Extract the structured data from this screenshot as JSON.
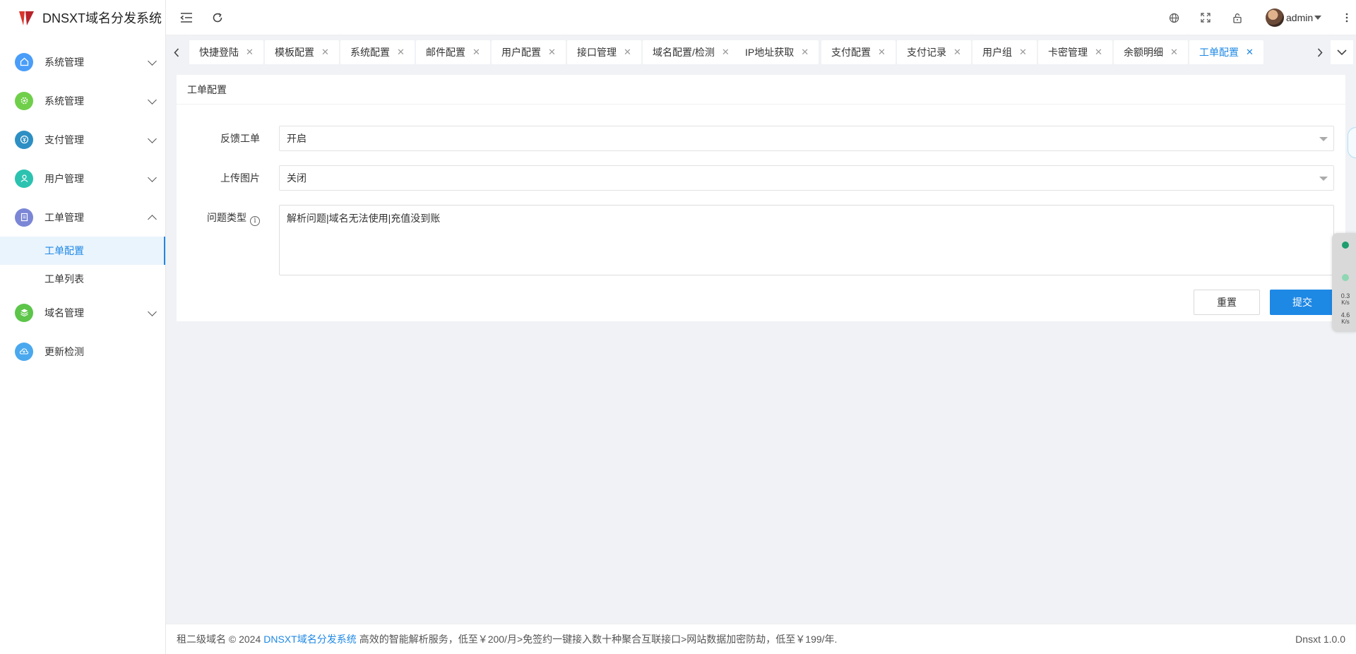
{
  "app": {
    "title": "DNSXT域名分发系统"
  },
  "sidebar": {
    "menus": [
      {
        "label": "系统管理",
        "icon": "home-icon",
        "color": "#4a9df8"
      },
      {
        "label": "系统管理",
        "icon": "gear-icon",
        "color": "#6fcf4a"
      },
      {
        "label": "支付管理",
        "icon": "payment-icon",
        "color": "#2d8fc4"
      },
      {
        "label": "用户管理",
        "icon": "user-icon",
        "color": "#2bc2b0"
      },
      {
        "label": "工单管理",
        "icon": "ticket-icon",
        "color": "#7b86d6"
      },
      {
        "label": "域名管理",
        "icon": "layers-icon",
        "color": "#5cc54a"
      },
      {
        "label": "更新检测",
        "icon": "cloud-icon",
        "color": "#4aa8ee"
      }
    ],
    "submenu": [
      "工单配置",
      "工单列表"
    ]
  },
  "header": {
    "user_name": "admin"
  },
  "tabs": [
    {
      "label": ""
    },
    {
      "label": "快捷登陆"
    },
    {
      "label": "模板配置"
    },
    {
      "label": "系统配置"
    },
    {
      "label": "邮件配置"
    },
    {
      "label": "用户配置"
    },
    {
      "label": "接口管理"
    },
    {
      "label": "域名配置/检测"
    },
    {
      "label": "IP地址获取"
    },
    {
      "label": "支付配置"
    },
    {
      "label": "支付记录"
    },
    {
      "label": "用户组"
    },
    {
      "label": "卡密管理"
    },
    {
      "label": "余额明细"
    },
    {
      "label": "工单配置"
    }
  ],
  "form": {
    "card_title": "工单配置",
    "feedback_label": "反馈工单",
    "feedback_value": "开启",
    "upload_label": "上传图片",
    "upload_value": "关闭",
    "type_label": "问题类型",
    "type_value": "解析问题|域名无法使用|充值没到账",
    "reset_label": "重置",
    "submit_label": "提交"
  },
  "float_widget": {
    "up_speed": "0.3",
    "up_unit": "K/s",
    "down_speed": "4.6",
    "down_unit": "K/s"
  },
  "footer": {
    "prefix": "租二级域名 © 2024",
    "link": "DNSXT域名分发系统",
    "text": "高效的智能解析服务，低至￥200/月>免签约一键接入数十种聚合互联接口>网站数据加密防劫，低至￥199/年.",
    "version": "Dnsxt 1.0.0"
  },
  "colors": {
    "accent": "#1e88e5",
    "brand_logo": "#d9362b"
  }
}
